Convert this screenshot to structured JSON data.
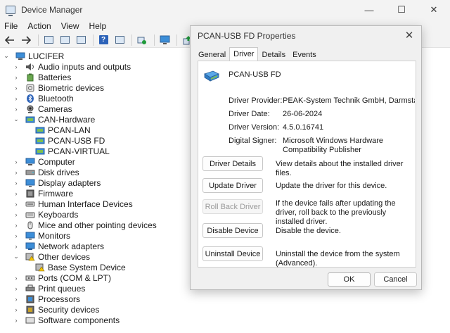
{
  "window": {
    "title": "Device Manager",
    "controls": {
      "minimize": "—",
      "maximize": "☐",
      "close": "✕"
    }
  },
  "menu": [
    "File",
    "Action",
    "View",
    "Help"
  ],
  "tree": {
    "root": "LUCIFER",
    "categories": [
      "Audio inputs and outputs",
      "Batteries",
      "Biometric devices",
      "Bluetooth",
      "Cameras",
      "CAN-Hardware",
      "Computer",
      "Disk drives",
      "Display adapters",
      "Firmware",
      "Human Interface Devices",
      "Keyboards",
      "Mice and other pointing devices",
      "Monitors",
      "Network adapters",
      "Other devices",
      "Ports (COM & LPT)",
      "Print queues",
      "Processors",
      "Security devices",
      "Software components"
    ],
    "can_children": [
      "PCAN-LAN",
      "PCAN-USB FD",
      "PCAN-VIRTUAL"
    ],
    "other_children": [
      "Base System Device"
    ]
  },
  "dialog": {
    "title": "PCAN-USB FD Properties",
    "close": "✕",
    "tabs": [
      "General",
      "Driver",
      "Details",
      "Events"
    ],
    "device_name": "PCAN-USB FD",
    "info": {
      "provider_label": "Driver Provider:",
      "provider_value": "PEAK-System Technik GmbH, Darmstadt, Germ",
      "date_label": "Driver Date:",
      "date_value": "26-06-2024",
      "version_label": "Driver Version:",
      "version_value": "4.5.0.16741",
      "signer_label": "Digital Signer:",
      "signer_value": "Microsoft Windows Hardware Compatibility Publisher"
    },
    "actions": [
      {
        "label": "Driver Details",
        "desc": "View details about the installed driver files."
      },
      {
        "label": "Update Driver",
        "desc": "Update the driver for this device."
      },
      {
        "label": "Roll Back Driver",
        "desc": "If the device fails after updating the driver, roll back to the previously installed driver."
      },
      {
        "label": "Disable Device",
        "desc": "Disable the device."
      },
      {
        "label": "Uninstall Device",
        "desc": "Uninstall the device from the system (Advanced)."
      }
    ],
    "ok": "OK",
    "cancel": "Cancel"
  },
  "colors": {
    "accent": "#2c62b8",
    "cancel_red": "#d42020",
    "green": "#1f9a3a"
  }
}
